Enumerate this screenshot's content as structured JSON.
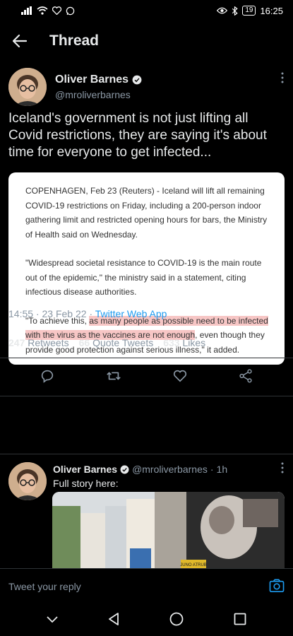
{
  "status_bar": {
    "battery": "19",
    "time": "16:25"
  },
  "header": {
    "title": "Thread"
  },
  "tweet": {
    "author_name": "Oliver Barnes",
    "author_handle": "@mroliverbarnes",
    "text": "Iceland's government is not just lifting all Covid restrictions, they are saying it's about time for everyone to get infected...",
    "article": {
      "p1": "COPENHAGEN, Feb 23 (Reuters) - Iceland will lift all remaining COVID-19 restrictions on Friday, including a 200-person indoor gathering limit and restricted opening hours for bars, the Ministry of Health said on Wednesday.",
      "p2": "\"Widespread societal resistance to COVID-19 is the main route out of the epidemic,\" the ministry said in a statement, citing infectious disease authorities.",
      "p3_before": "\"To achieve this, ",
      "p3_highlight": "as many people as possible need to be infected with the virus as the vaccines are not enough",
      "p3_after": ", even though they provide good protection against serious illness,\" it added."
    },
    "time": "14:55",
    "date": "23 Feb 22",
    "client": "Twitter Web App",
    "retweets_count": "247",
    "retweets_label": "Retweets",
    "quotes_count": "66",
    "quotes_label": "Quote Tweets",
    "likes_count": "633",
    "likes_label": "Likes"
  },
  "reply": {
    "author_name": "Oliver Barnes",
    "author_handle": "@mroliverbarnes",
    "age": "1h",
    "text": "Full story here:",
    "sign_text": "JUNO ATRUB"
  },
  "composer": {
    "placeholder": "Tweet your reply"
  },
  "colors": {
    "accent": "#1d9bf0",
    "background": "#000000",
    "muted": "#8b98a5",
    "highlight": "#f7c6c5"
  }
}
